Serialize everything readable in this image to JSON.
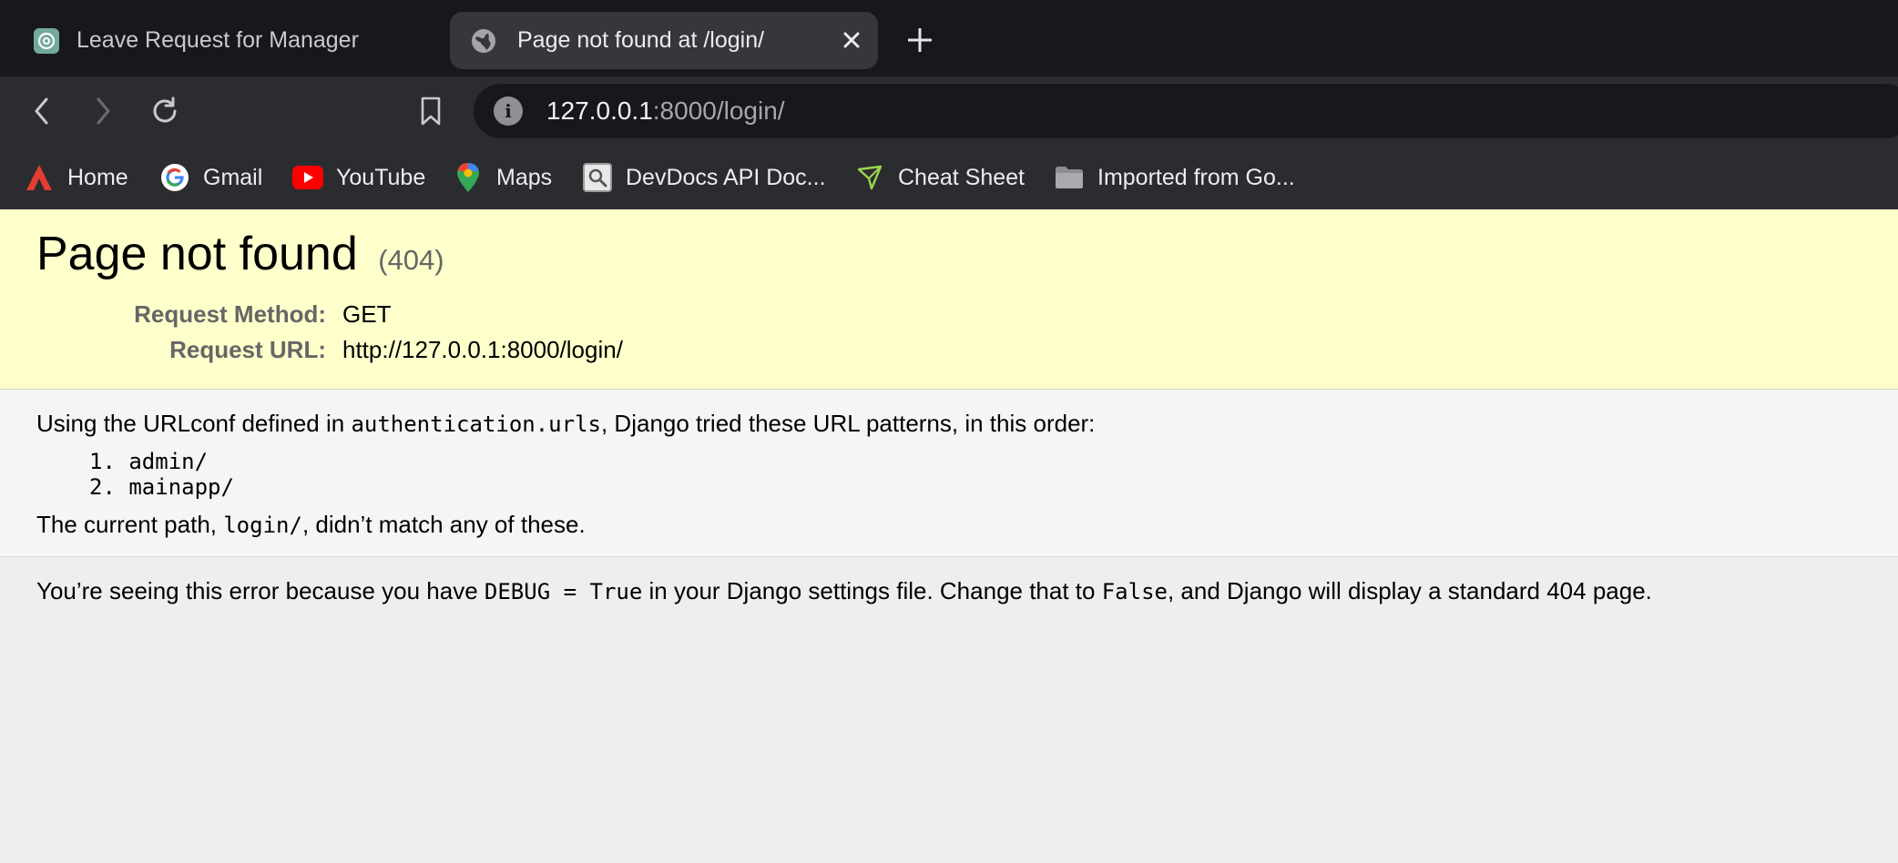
{
  "browser": {
    "tabs": [
      {
        "title": "Leave Request for Manager",
        "icon": "chatgpt-icon",
        "active": false
      },
      {
        "title": "Page not found at /login/",
        "icon": "globe-icon",
        "active": true
      }
    ],
    "address_bar": {
      "host": "127.0.0.1",
      "rest": ":8000/login/"
    },
    "bookmarks": [
      {
        "label": "Home",
        "icon": "arch-icon"
      },
      {
        "label": "Gmail",
        "icon": "google-icon"
      },
      {
        "label": "YouTube",
        "icon": "youtube-icon"
      },
      {
        "label": "Maps",
        "icon": "maps-pin-icon"
      },
      {
        "label": "DevDocs API Doc...",
        "icon": "devdocs-icon"
      },
      {
        "label": "Cheat Sheet",
        "icon": "cheat-sheet-icon"
      },
      {
        "label": "Imported from Go...",
        "icon": "folder-icon"
      }
    ]
  },
  "error_page": {
    "title": "Page not found",
    "status_code": "(404)",
    "request_method_label": "Request Method:",
    "request_method": "GET",
    "request_url_label": "Request URL:",
    "request_url": "http://127.0.0.1:8000/login/",
    "urlconf_text_before": "Using the URLconf defined in ",
    "urlconf_module": "authentication.urls",
    "urlconf_text_after": ", Django tried these URL patterns, in this order:",
    "patterns": [
      "1. admin/",
      "2. mainapp/"
    ],
    "current_path_before": "The current path, ",
    "current_path": "login/",
    "current_path_after": ", didn’t match any of these.",
    "debug_before": "You’re seeing this error because you have ",
    "debug_setting": "DEBUG = True",
    "debug_middle": " in your Django settings file. Change that to ",
    "debug_false": "False",
    "debug_after": ", and Django will display a standard 404 page."
  }
}
